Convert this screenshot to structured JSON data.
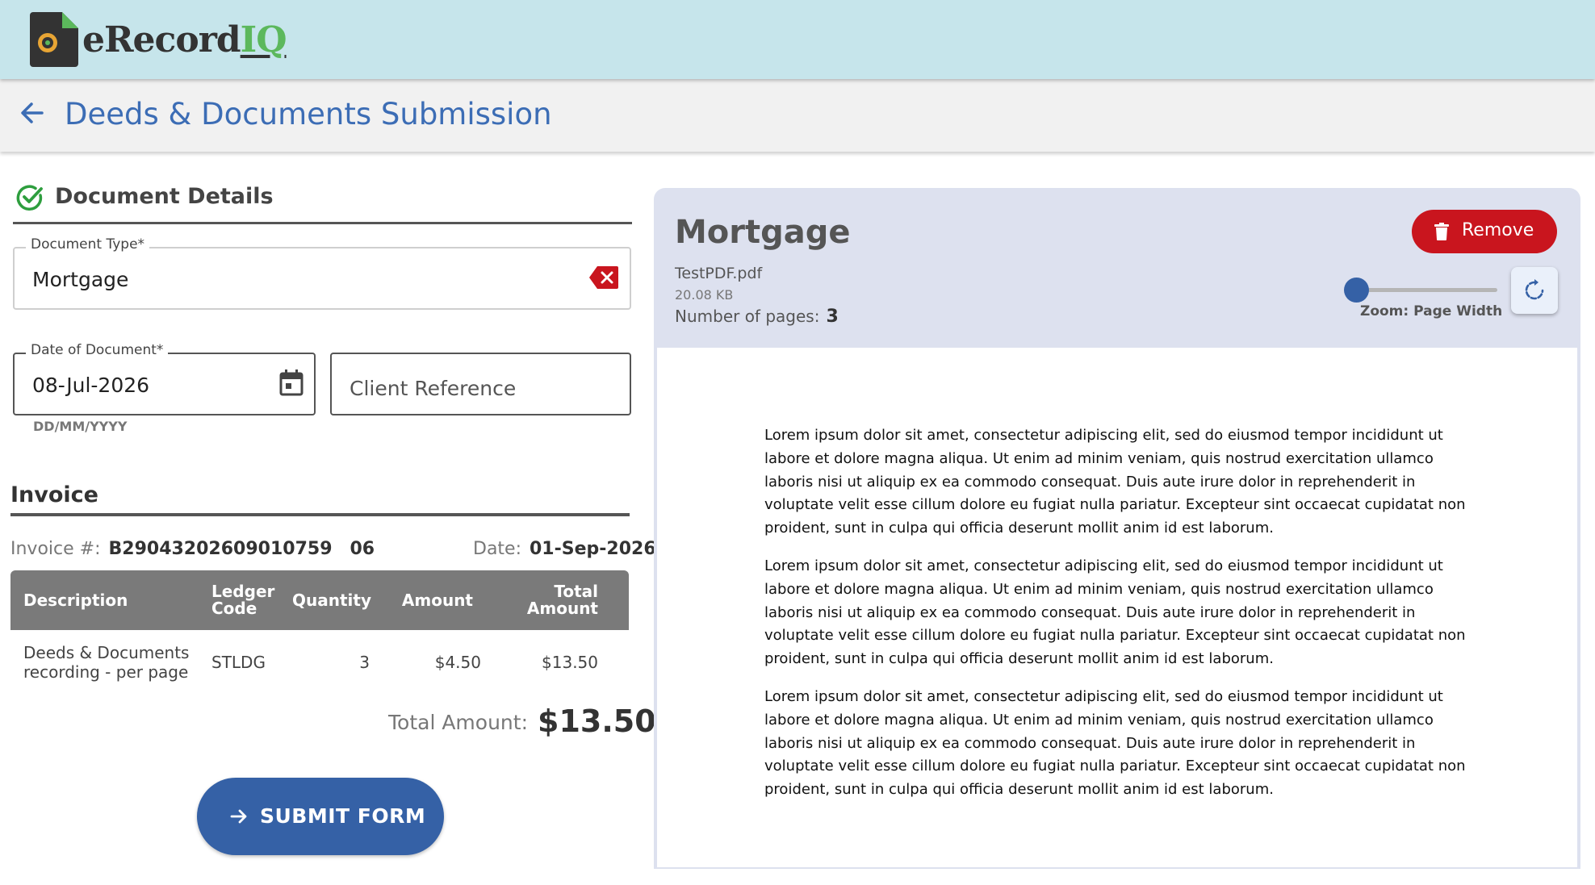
{
  "app": {
    "logo_text": "eRecord",
    "logo_accent": "IQ",
    "page_title": "Deeds & Documents Submission"
  },
  "document_details": {
    "section_title": "Document Details",
    "document_type": {
      "label": "Document Type*",
      "value": "Mortgage"
    },
    "date_of_document": {
      "label": "Date of Document*",
      "value": "08-Jul-2026",
      "hint": "DD/MM/YYYY"
    },
    "client_reference": {
      "placeholder": "Client Reference"
    }
  },
  "invoice": {
    "title": "Invoice",
    "number_label": "Invoice #:",
    "number": "B29043202609010759 06",
    "date_label": "Date:",
    "date": "01-Sep-2026",
    "columns": [
      "Description",
      "Ledger Code",
      "Quantity",
      "Amount",
      "Total Amount"
    ],
    "rows": [
      {
        "description": "Deeds & Documents recording - per page",
        "ledger_code": "STLDG",
        "quantity": "3",
        "amount": "$4.50",
        "total": "$13.50"
      }
    ],
    "total_label": "Total Amount:",
    "total_value": "$13.50"
  },
  "submit": {
    "label": "SUBMIT FORM"
  },
  "viewer": {
    "title": "Mortgage",
    "file_name": "TestPDF.pdf",
    "file_size": "20.08 KB",
    "pages_label": "Number of pages:",
    "pages_value": "3",
    "remove_label": "Remove",
    "zoom_label": "Zoom: Page Width",
    "zoom_level": 0.0,
    "paragraphs": [
      "Lorem ipsum dolor sit amet, consectetur adipiscing elit, sed do eiusmod tempor incididunt ut labore et dolore magna aliqua. Ut enim ad minim veniam, quis nostrud exercitation ullamco laboris nisi ut aliquip ex ea commodo consequat. Duis aute irure dolor in reprehenderit in voluptate velit esse cillum dolore eu fugiat nulla pariatur. Excepteur sint occaecat cupidatat non proident, sunt in culpa qui officia deserunt mollit anim id est laborum.",
      "Lorem ipsum dolor sit amet, consectetur adipiscing elit, sed do eiusmod tempor incididunt ut labore et dolore magna aliqua. Ut enim ad minim veniam, quis nostrud exercitation ullamco laboris nisi ut aliquip ex ea commodo consequat. Duis aute irure dolor in reprehenderit in voluptate velit esse cillum dolore eu fugiat nulla pariatur. Excepteur sint occaecat cupidatat non proident, sunt in culpa qui officia deserunt mollit anim id est laborum.",
      "Lorem ipsum dolor sit amet, consectetur adipiscing elit, sed do eiusmod tempor incididunt ut labore et dolore magna aliqua. Ut enim ad minim veniam, quis nostrud exercitation ullamco laboris nisi ut aliquip ex ea commodo consequat. Duis aute irure dolor in reprehenderit in voluptate velit esse cillum dolore eu fugiat nulla pariatur. Excepteur sint occaecat cupidatat non proident, sunt in culpa qui officia deserunt mollit anim id est laborum."
    ]
  },
  "colors": {
    "appbar": "#c6e5eb",
    "title_blue": "#3c6db5",
    "primary": "#3561a6",
    "danger": "#c9151e",
    "success": "#2e9e3e"
  },
  "icons": [
    "back-arrow-icon",
    "check-circle-icon",
    "clear-icon",
    "calendar-icon",
    "arrow-right-icon",
    "trash-icon",
    "rotate-icon"
  ]
}
